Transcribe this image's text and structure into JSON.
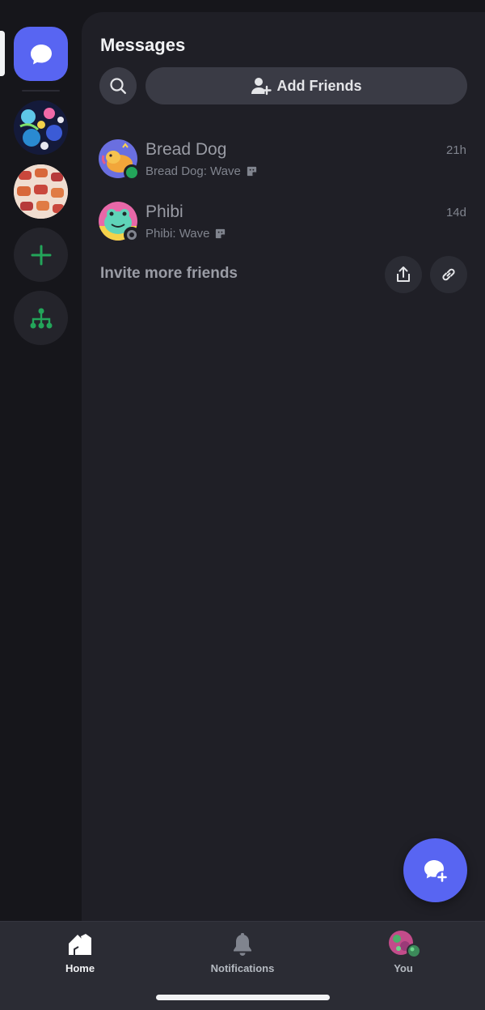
{
  "rail": {
    "servers": [
      "server-art",
      "server-food"
    ],
    "icons": [
      "chat-bubble-icon",
      "plus-icon",
      "hub-icon"
    ]
  },
  "header": {
    "title": "Messages",
    "add_friends_label": "Add Friends"
  },
  "dms": [
    {
      "name": "Bread Dog",
      "preview": "Bread Dog: Wave",
      "time": "21h",
      "status": "online"
    },
    {
      "name": "Phibi",
      "preview": "Phibi: Wave",
      "time": "14d",
      "status": "offline"
    }
  ],
  "invite": {
    "label": "Invite more friends"
  },
  "nav": {
    "home": "Home",
    "notifications": "Notifications",
    "you": "You"
  },
  "colors": {
    "accent": "#5865f2",
    "online": "#23a55a",
    "panel": "#1f1f26",
    "rail": "#16161b"
  }
}
